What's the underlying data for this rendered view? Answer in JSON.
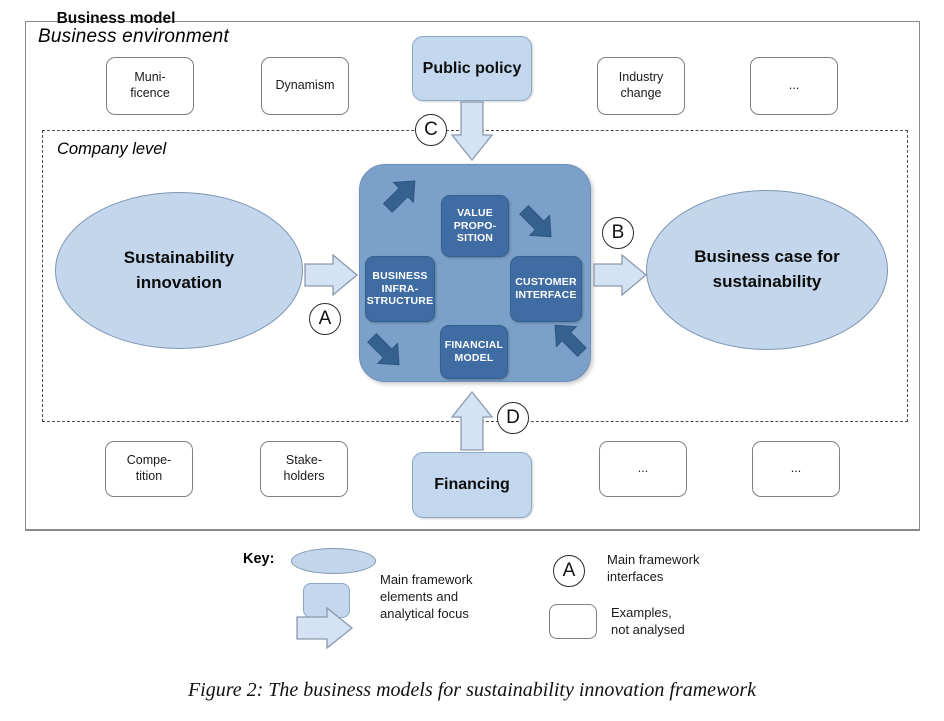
{
  "environment": {
    "label": "Business environment",
    "examples_top": [
      {
        "name": "munificence",
        "text": "Muni-\nficence"
      },
      {
        "name": "dynamism",
        "text": "Dynamism"
      },
      {
        "name": "industry-change",
        "text": "Industry\nchange"
      },
      {
        "name": "ellipsis-top",
        "text": "..."
      }
    ],
    "examples_bottom": [
      {
        "name": "competition",
        "text": "Compe-\ntition"
      },
      {
        "name": "stakeholders",
        "text": "Stake-\nholders"
      },
      {
        "name": "ellipsis-bottom-1",
        "text": "..."
      },
      {
        "name": "ellipsis-bottom-2",
        "text": "..."
      }
    ],
    "focus_top": {
      "name": "public-policy",
      "text": "Public policy"
    },
    "focus_bottom": {
      "name": "financing",
      "text": "Financing"
    }
  },
  "company": {
    "label": "Company level",
    "left_ellipse": "Sustainability\ninnovation",
    "right_ellipse": "Business case for\nsustainability"
  },
  "business_model": {
    "title": "Business model",
    "components": [
      {
        "name": "value-proposition",
        "text": "VALUE\nPROPO-\nSITION"
      },
      {
        "name": "business-infrastructure",
        "text": "BUSINESS\nINFRA-\nSTRUCTURE"
      },
      {
        "name": "customer-interface",
        "text": "CUSTOMER\nINTERFACE"
      },
      {
        "name": "financial-model",
        "text": "FINANCIAL\nMODEL"
      }
    ]
  },
  "interfaces": [
    {
      "name": "interface-a",
      "label": "A"
    },
    {
      "name": "interface-b",
      "label": "B"
    },
    {
      "name": "interface-c",
      "label": "C"
    },
    {
      "name": "interface-d",
      "label": "D"
    }
  ],
  "key": {
    "title": "Key:",
    "main_elements_text": "Main framework\nelements and\nanalytical focus",
    "interfaces_text": "Main framework\ninterfaces",
    "interfaces_marker": "A",
    "examples_text": "Examples,\nnot analysed"
  },
  "caption": "Figure 2: The business models for sustainability innovation framework",
  "colors": {
    "focus_fill": "#c3d8ef",
    "ellipse_fill": "#c3d6ec",
    "bm_fill": "#7ba0c9",
    "bm_inner_fill": "#3f6da3",
    "frame_stroke": "#8a8a8a",
    "dashed_stroke": "#4b4b4b"
  }
}
